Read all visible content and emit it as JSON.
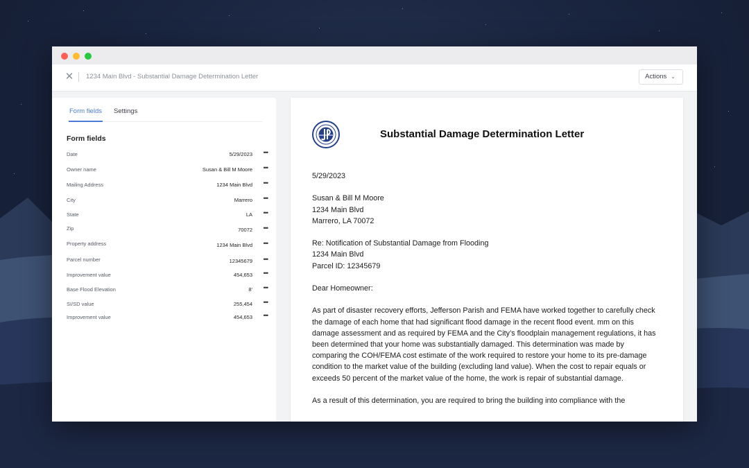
{
  "window": {
    "title": "1234 Main Blvd - Substantial Damage Determination Letter",
    "actions_label": "Actions"
  },
  "left_panel": {
    "tabs": [
      {
        "label": "Form fields"
      },
      {
        "label": "Settings"
      }
    ],
    "heading": "Form fields",
    "fields": [
      {
        "label": "Date",
        "value": "5/29/2023"
      },
      {
        "label": "Owner name",
        "value": "Susan & Bill M Moore"
      },
      {
        "label": "Mailing Address",
        "value": "1234 Main Blvd"
      },
      {
        "label": "City",
        "value": "Marrero"
      },
      {
        "label": "State",
        "value": "LA"
      },
      {
        "label": "Zip",
        "value": "70072"
      },
      {
        "label": "Property address",
        "value": "1234 Main Blvd"
      },
      {
        "label": "Parcel number",
        "value": "12345679"
      },
      {
        "label": "Improvement value",
        "value": "454,653"
      },
      {
        "label": "Base Flood Elevation",
        "value": "8'"
      },
      {
        "label": "SI/SD value",
        "value": "255,454"
      },
      {
        "label": "Improvement value",
        "value": "454,653"
      }
    ]
  },
  "letter": {
    "title": "Substantial Damage Determination Letter",
    "date": "5/29/2023",
    "recipient": [
      "Susan & Bill M Moore",
      "1234 Main Blvd",
      "Marrero, LA 70072"
    ],
    "re": [
      "Re: Notification of Substantial Damage from Flooding",
      "1234 Main Blvd",
      "Parcel ID: 12345679"
    ],
    "salutation": "Dear Homeowner:",
    "paragraph1": "As part of disaster recovery efforts, Jefferson Parish and FEMA have worked together to carefully check the damage of each home that had significant flood damage in the recent flood event. mm on this damage assessment and as required by FEMA and the City’s floodplain management regulations, it has been determined that your home was substantially damaged. This determination was made by comparing the COH/FEMA cost estimate of the work required to restore your home to its pre-damage condition to the market value of the building (excluding land value). When the cost to repair equals or exceeds 50 percent of the market value of the home, the work is repair of substantial damage.",
    "paragraph2": "As a result of this determination, you are required to bring the building into compliance with the"
  },
  "colors": {
    "accent": "#4a7bd6",
    "seal_blue": "#23418a"
  }
}
